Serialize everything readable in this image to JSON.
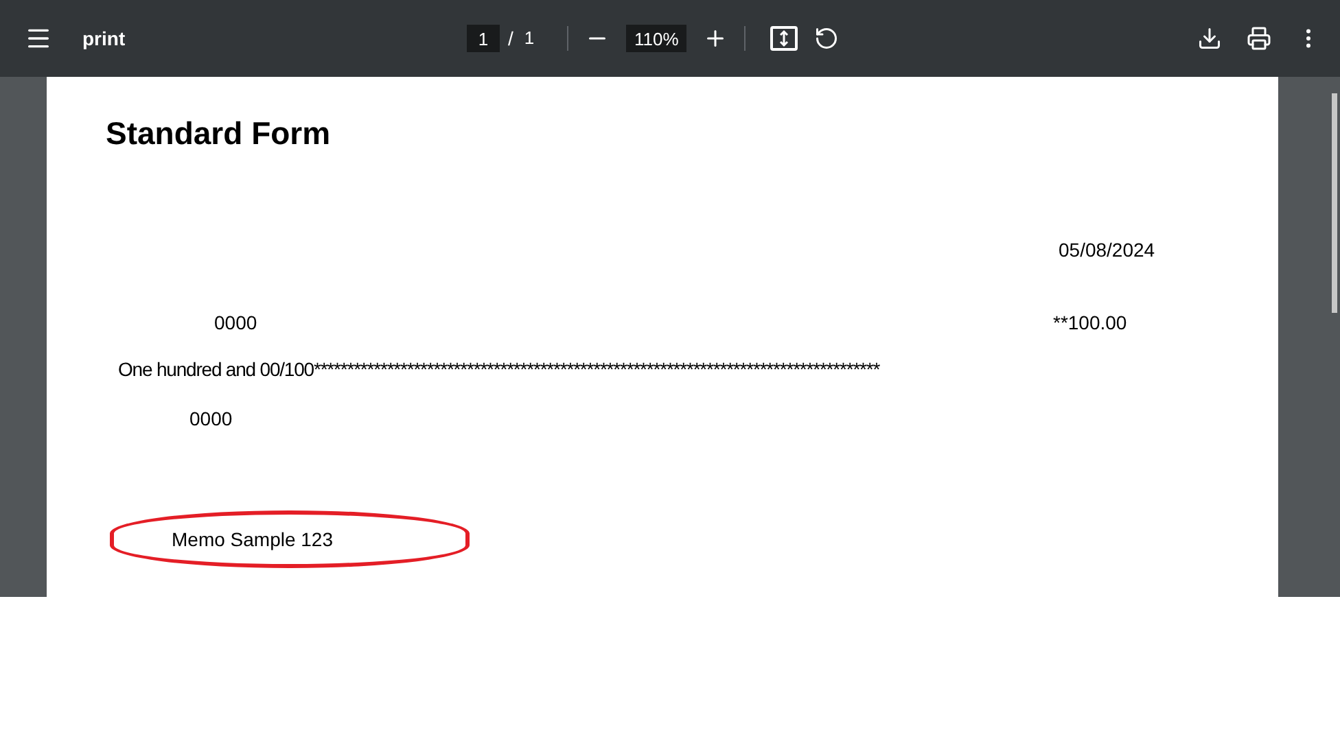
{
  "toolbar": {
    "title": "print",
    "page_current": "1",
    "page_separator": "/",
    "page_total": "1",
    "zoom": "110%"
  },
  "document": {
    "heading": "Standard Form",
    "date": "05/08/2024",
    "payee_code": "0000",
    "amount": "**100.00",
    "amount_words": "One hundred and 00/100*************************************************************************************",
    "address_code": "0000",
    "memo": "Memo Sample 123",
    "memo_highlighted": true
  }
}
